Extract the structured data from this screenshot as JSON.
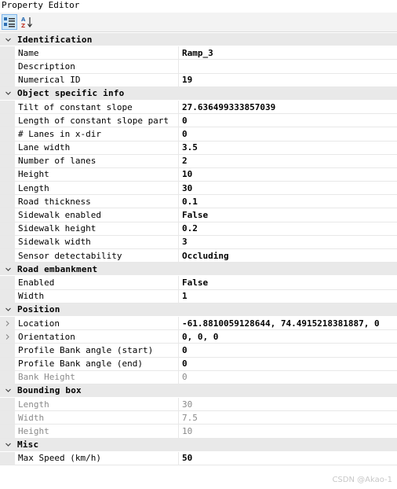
{
  "window": {
    "title": "Property Editor"
  },
  "toolbar": {
    "categorized_icon": "categorized-view-icon",
    "alphabetical_icon": "alphabetical-sort-icon"
  },
  "categories": [
    {
      "label": "Identification",
      "props": [
        {
          "name": "Name",
          "value": "Ramp_3"
        },
        {
          "name": "Description",
          "value": ""
        },
        {
          "name": "Numerical ID",
          "value": "19"
        }
      ]
    },
    {
      "label": "Object specific info",
      "props": [
        {
          "name": "Tilt of constant slope",
          "value": "27.636499333857039"
        },
        {
          "name": "Length of constant slope part",
          "value": "0"
        },
        {
          "name": "# Lanes in x-dir",
          "value": "0"
        },
        {
          "name": "Lane width",
          "value": "3.5"
        },
        {
          "name": "Number of lanes",
          "value": "2"
        },
        {
          "name": "Height",
          "value": "10"
        },
        {
          "name": "Length",
          "value": "30"
        },
        {
          "name": "Road thickness",
          "value": "0.1"
        },
        {
          "name": "Sidewalk enabled",
          "value": "False"
        },
        {
          "name": "Sidewalk height",
          "value": "0.2"
        },
        {
          "name": "Sidewalk width",
          "value": "3"
        },
        {
          "name": "Sensor detectability",
          "value": "Occluding"
        }
      ]
    },
    {
      "label": "Road embankment",
      "props": [
        {
          "name": "Enabled",
          "value": "False"
        },
        {
          "name": "Width",
          "value": "1"
        }
      ]
    },
    {
      "label": "Position",
      "props": [
        {
          "name": "Location",
          "value": "-61.8810059128644, 74.4915218381887, 0"
        },
        {
          "name": "Orientation",
          "value": "0, 0, 0"
        },
        {
          "name": "Profile Bank angle (start)",
          "value": "0"
        },
        {
          "name": "Profile Bank angle (end)",
          "value": "0"
        },
        {
          "name": "Bank Height",
          "value": "0"
        }
      ]
    },
    {
      "label": "Bounding box",
      "props": [
        {
          "name": "Length",
          "value": "30"
        },
        {
          "name": "Width",
          "value": "7.5"
        },
        {
          "name": "Height",
          "value": "10"
        }
      ]
    },
    {
      "label": "Misc",
      "props": [
        {
          "name": "Max Speed (km/h)",
          "value": "50"
        }
      ]
    }
  ],
  "watermark": "CSDN @Akao-1"
}
